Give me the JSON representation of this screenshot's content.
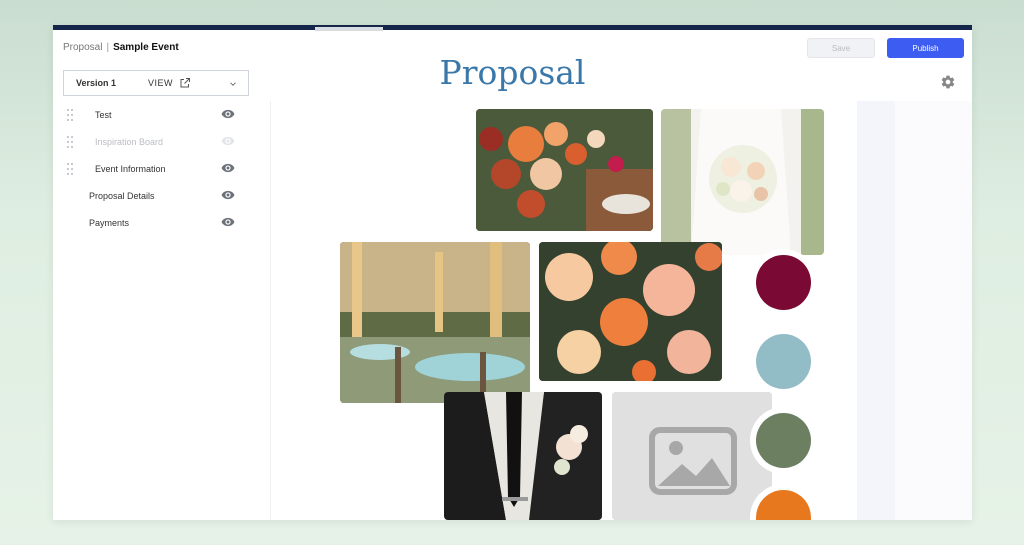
{
  "breadcrumb": {
    "root": "Proposal",
    "separator": "|",
    "event": "Sample Event"
  },
  "toolbar": {
    "save_label": "Save",
    "publish_label": "Publish"
  },
  "page": {
    "title": "Proposal"
  },
  "version": {
    "label": "Version 1",
    "view_label": "VIEW"
  },
  "sections": [
    {
      "label": "Test",
      "visible": true,
      "draggable": true
    },
    {
      "label": "Inspiration Board",
      "visible": false,
      "draggable": true
    },
    {
      "label": "Event Information",
      "visible": true,
      "draggable": true
    },
    {
      "label": "Proposal Details",
      "visible": true,
      "draggable": false
    },
    {
      "label": "Payments",
      "visible": true,
      "draggable": false
    }
  ],
  "board": {
    "photos": [
      {
        "name": "table-floral-centerpiece"
      },
      {
        "name": "bridal-bouquet"
      },
      {
        "name": "string-lights-reception"
      },
      {
        "name": "peach-roses"
      },
      {
        "name": "groom-boutonniere"
      },
      {
        "name": "image-placeholder"
      }
    ],
    "palette": [
      "#7a0a33",
      "#92bcc6",
      "#6c7f60",
      "#e8781e"
    ]
  },
  "icons": {
    "gear": "gear-icon",
    "eye": "eye-icon",
    "drag": "drag-handle-icon",
    "external": "external-link-icon",
    "chevron": "chevron-down-icon"
  }
}
